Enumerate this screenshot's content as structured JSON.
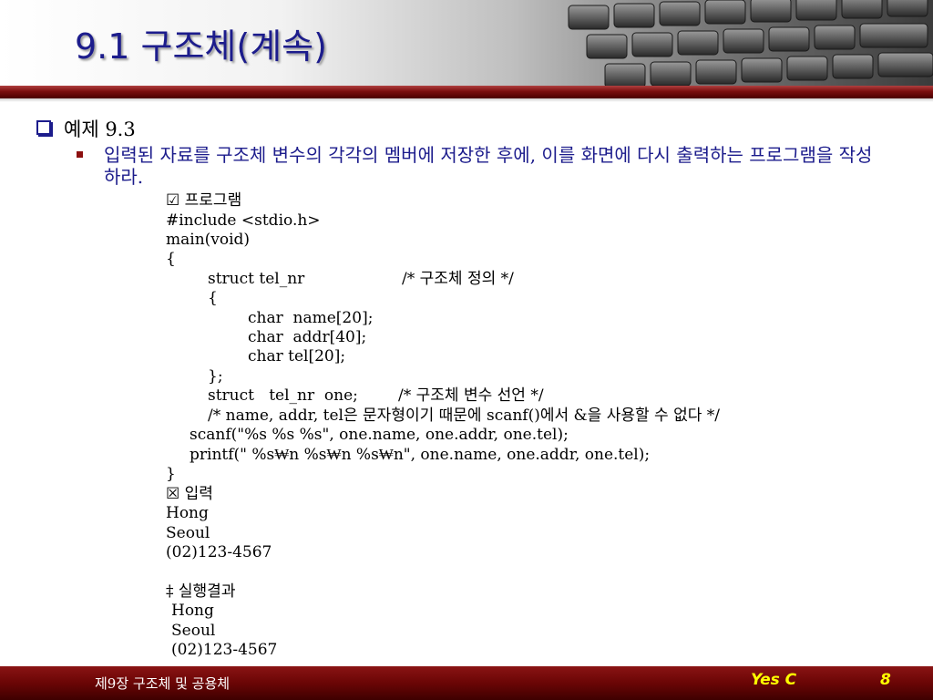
{
  "slide": {
    "title": "9.1 구조체(계속)",
    "heading": "예제 9.3",
    "description": "입력된 자료를 구조체 변수의 각각의 멤버에 저장한 후에, 이를 화면에 다시 출력하는 프로그램을 작성하라.",
    "code_lines": [
      "☑ 프로그램",
      "#include <stdio.h>",
      "main(void)",
      "{",
      "struct tel_nr",
      "/* 구조체 정의 */",
      "{",
      "char  name[20];",
      "char  addr[40];",
      "char tel[20];",
      "};",
      "struct   tel_nr  one;",
      "/* 구조체 변수 선언 */",
      "/* name, addr, tel은 문자형이기 때문에 scanf()에서 &을 사용할 수 없다 */",
      "scanf(\"%s %s %s\", one.name, one.addr, one.tel);",
      "printf(\" %s₩n %s₩n %s₩n\", one.name, one.addr, one.tel);",
      "}",
      "☒ 입력",
      "Hong",
      "Seoul",
      "(02)123-4567",
      "‡ 실행결과",
      "Hong",
      "Seoul",
      "(02)123-4567"
    ]
  },
  "footer": {
    "chapter": "제9장 구조체 및 공용체",
    "brand": "Yes C",
    "page_number": "8"
  },
  "colors": {
    "title": "#1c1c8c",
    "bar": "#7a0e0e",
    "footer_text_accent": "#ffff00"
  }
}
